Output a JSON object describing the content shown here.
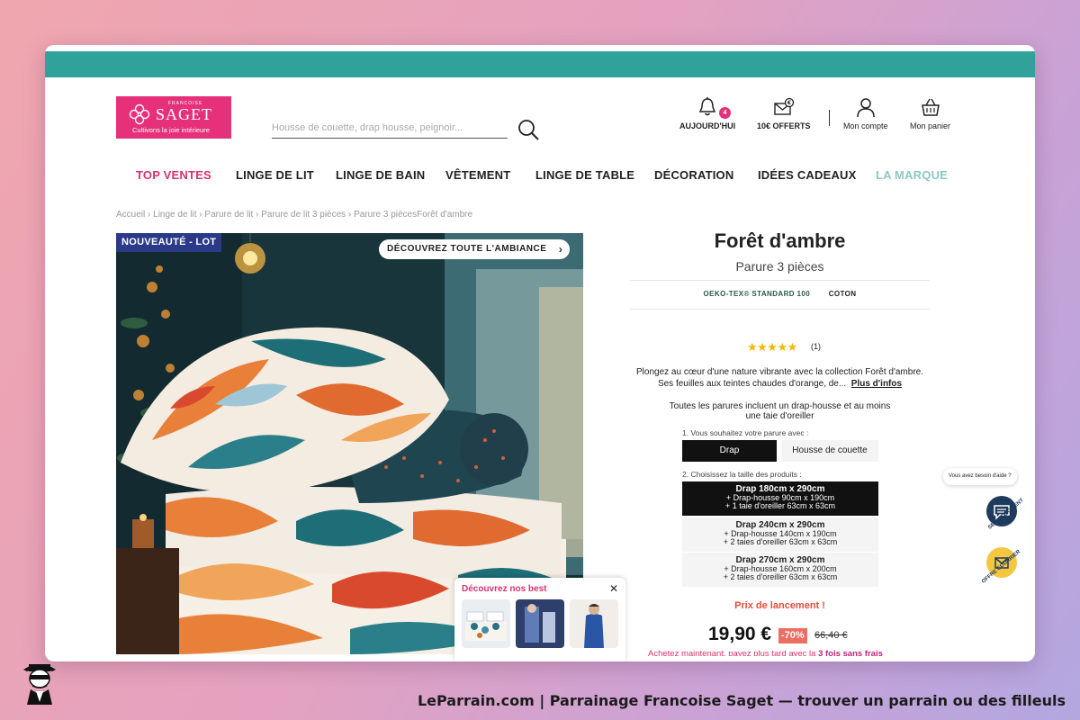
{
  "logo": {
    "small": "FRANCOISE",
    "name": "SAGET",
    "tagline": "Cultivons la joie intérieure"
  },
  "search": {
    "placeholder": "Housse de couette, drap housse, peignoir..."
  },
  "header": {
    "today_label": "AUJOURD'HUI",
    "today_badge": "4",
    "gift_label": "10€ OFFERTS",
    "account_label": "Mon compte",
    "cart_label": "Mon panier"
  },
  "nav": {
    "items": [
      "TOP VENTES",
      "LINGE DE LIT",
      "LINGE DE BAIN",
      "VÊTEMENT",
      "LINGE DE TABLE",
      "DÉCORATION",
      "IDÉES CADEAUX",
      "LA MARQUE"
    ]
  },
  "breadcrumb": [
    "Accueil",
    "Linge de lit",
    "Parure de lit",
    "Parure de lit 3 pièces",
    "Parure 3 pièces",
    "Forêt d'ambre"
  ],
  "image": {
    "badge": "NOUVEAUTÉ - LOT",
    "ambiance_button": "DÉCOUVREZ TOUTE L'AMBIANCE"
  },
  "best_popup": {
    "title": "Découvrez nos best",
    "close": "✕"
  },
  "product": {
    "title": "Forêt d'ambre",
    "subtitle": "Parure 3 pièces",
    "label1": "OEKO-TEX® STANDARD 100",
    "label2": "COTON",
    "stars": "★★★★★",
    "rating_count": "(1)",
    "description": "Plongez au cœur d'une nature vibrante avec la collection Forêt d'ambre. Ses feuilles aux teintes chaudes d'orange, de...",
    "more_info": "Plus d'infos",
    "note": "Toutes les parures incluent un drap-housse et au moins une taie d'oreiller",
    "step1": "1. Vous souhaitez votre parure avec :",
    "option_drap": "Drap",
    "option_housse": "Housse de couette",
    "step2": "2. Choisissez la taille des produits :",
    "sizes": [
      {
        "main": "Drap 180cm x 290cm",
        "l2": "+ Drap-housse 90cm x 190cm",
        "l3": "+ 1 taie d'oreiller 63cm x 63cm"
      },
      {
        "main": "Drap 240cm x 290cm",
        "l2": "+ Drap-housse 140cm x 190cm",
        "l3": "+ 2 taies d'oreiller 63cm x 63cm"
      },
      {
        "main": "Drap 270cm x 290cm",
        "l2": "+ Drap-housse 160cm x 200cm",
        "l3": "+ 2 taies d'oreiller 63cm x 63cm"
      }
    ],
    "launch": "Prix de lancement !",
    "price": "19,90 €",
    "discount": "-70%",
    "old_price": "66,40 €",
    "later_prefix": "Achetez maintenant, payez plus tard avec la ",
    "later_bold": "3 fois sans frais"
  },
  "floating": {
    "help": "Vous avez besoin d'aide ?",
    "service": "SERVICE CLIENT",
    "offre": "OFFRE COURRIER"
  },
  "footer": {
    "text": "LeParrain.com | Parrainage Francoise Saget — trouver un parrain ou des filleuls"
  },
  "colors": {
    "teal": "#31a29a",
    "pink": "#e6307a",
    "navy": "#2b3a86",
    "discount": "#ec6e63"
  }
}
